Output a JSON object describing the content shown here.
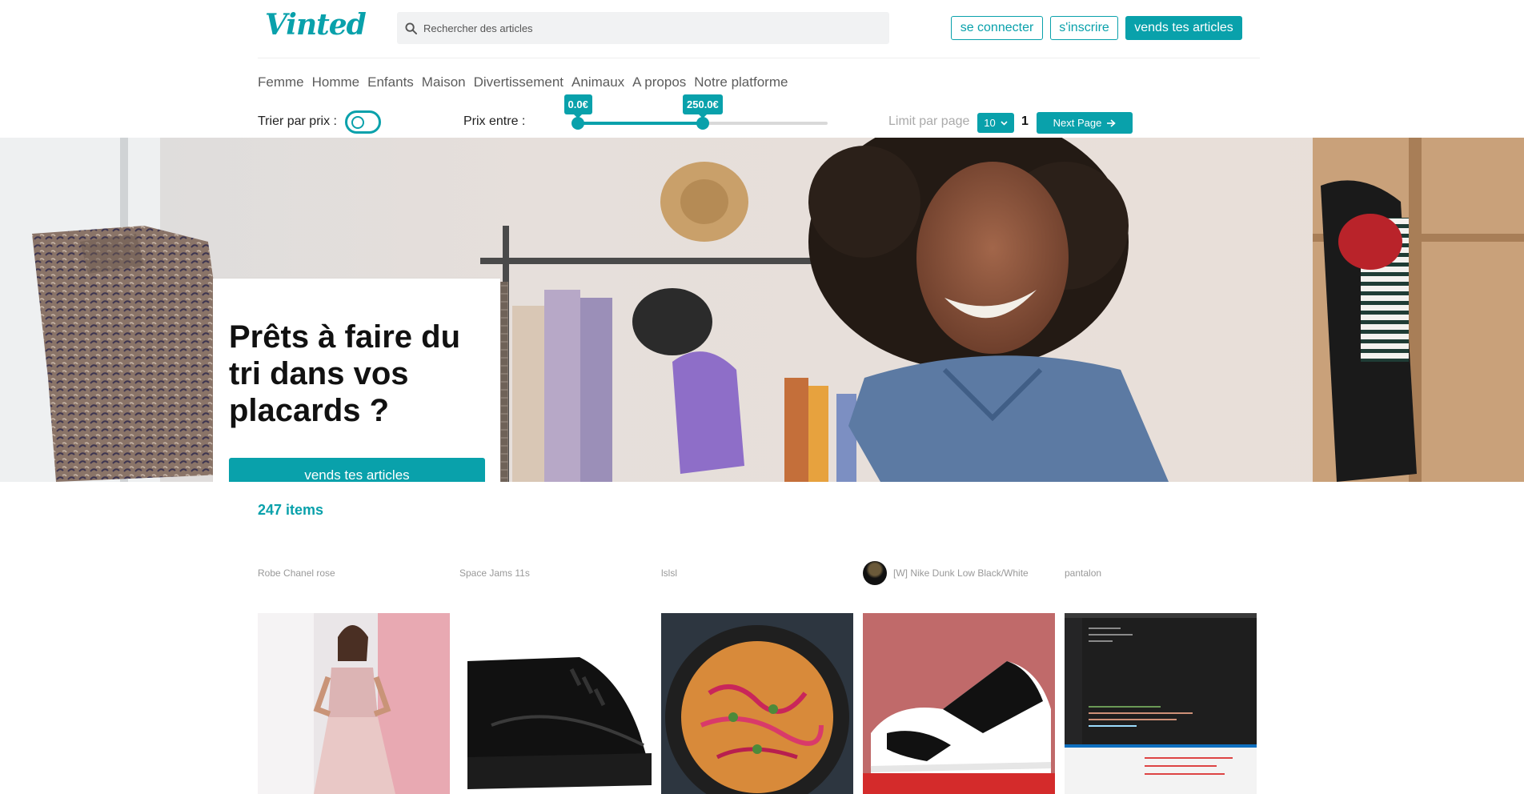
{
  "header": {
    "logo": "Vinted",
    "search_placeholder": "Rechercher des articles",
    "login_label": "se connecter",
    "signup_label": "s'inscrire",
    "sell_label": "vends tes articles"
  },
  "nav": {
    "categories": [
      "Femme",
      "Homme",
      "Enfants",
      "Maison",
      "Divertissement",
      "Animaux",
      "A propos",
      "Notre platforme"
    ]
  },
  "filters": {
    "sort_label": "Trier par prix :",
    "sort_toggle_on": false,
    "price_label": "Prix entre :",
    "price_min": "0.0€",
    "price_max": "250.0€",
    "price_min_fraction": 0.0,
    "price_max_fraction": 0.5,
    "limit_label": "Limit par page",
    "limit_value": "10",
    "page_number": "1",
    "next_label": "Next Page"
  },
  "hero": {
    "title": "Prêts à faire du tri dans vos placards ?",
    "cta_label": "vends tes articles"
  },
  "items": {
    "count_label": "247 items",
    "list": [
      {
        "title": "Robe Chanel rose"
      },
      {
        "title": "Space Jams 11s"
      },
      {
        "title": "lslsl"
      },
      {
        "title": "[W] Nike Dunk Low Black/White"
      },
      {
        "title": "pantalon"
      }
    ]
  },
  "colors": {
    "accent": "#09a1ab",
    "muted_text": "#999999",
    "search_bg": "#f1f2f3"
  }
}
